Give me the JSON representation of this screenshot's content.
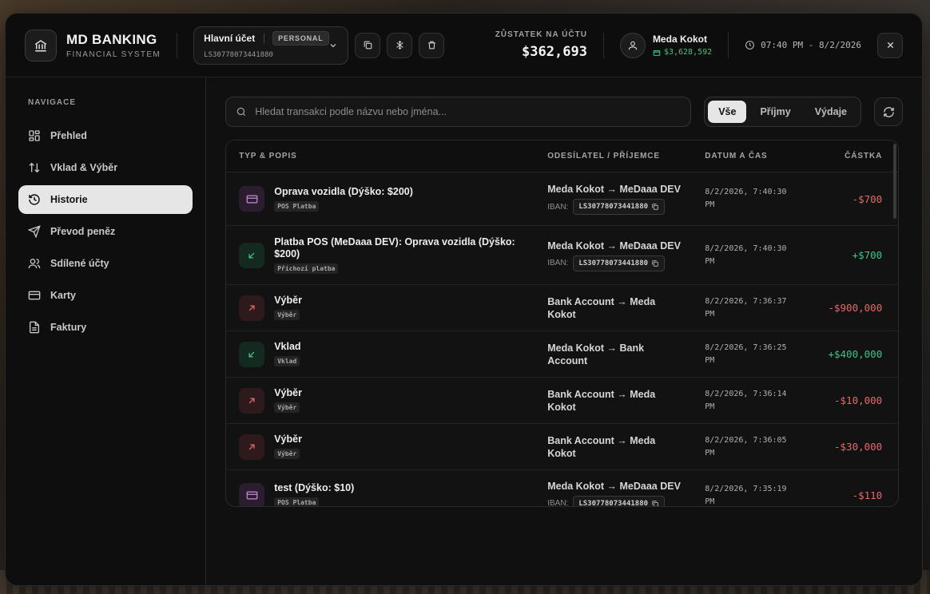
{
  "brand": {
    "title": "MD BANKING",
    "subtitle": "FINANCIAL SYSTEM"
  },
  "account": {
    "name": "Hlavní účet",
    "type_badge": "PERSONAL",
    "iban": "LS30778073441880"
  },
  "balance": {
    "label": "ZŮSTATEK NA ÚČTU",
    "value": "$362,693"
  },
  "user": {
    "name": "Meda Kokot",
    "cash": "$3,628,592"
  },
  "clock": {
    "text": "07:40 PM - 8/2/2026"
  },
  "nav": {
    "title": "NAVIGACE",
    "items": [
      {
        "label": "Přehled",
        "icon": "grid-icon"
      },
      {
        "label": "Vklad & Výběr",
        "icon": "arrows-up-down-icon"
      },
      {
        "label": "Historie",
        "icon": "history-icon",
        "active": true
      },
      {
        "label": "Převod peněz",
        "icon": "send-icon"
      },
      {
        "label": "Sdílené účty",
        "icon": "users-icon"
      },
      {
        "label": "Karty",
        "icon": "card-icon"
      },
      {
        "label": "Faktury",
        "icon": "invoice-icon"
      }
    ]
  },
  "search": {
    "placeholder": "Hledat transakci podle názvu nebo jména..."
  },
  "filters": [
    "Vše",
    "Příjmy",
    "Výdaje"
  ],
  "table": {
    "headers": [
      "TYP & POPIS",
      "ODESÍLATEL / PŘÍJEMCE",
      "DATUM A ČAS",
      "ČÁSTKA"
    ],
    "iban_label": "IBAN:",
    "rows": [
      {
        "kind": "pos",
        "title": "Oprava vozidla (Dýško: $200)",
        "tag": "POS Platba",
        "party": "Meda Kokot → MeDaaa DEV",
        "iban": "LS30778073441880",
        "date": "8/2/2026, 7:40:30",
        "ampm": "PM",
        "amount": "-$700",
        "sign": "neg"
      },
      {
        "kind": "in",
        "title": "Platba POS (MeDaaa DEV): Oprava vozidla (Dýško: $200)",
        "tag": "Příchozí platba",
        "party": "Meda Kokot → MeDaaa DEV",
        "iban": "LS30778073441880",
        "date": "8/2/2026, 7:40:30",
        "ampm": "PM",
        "amount": "+$700",
        "sign": "pos"
      },
      {
        "kind": "out",
        "title": "Výběr",
        "tag": "Výběr",
        "party": "Bank Account → Meda Kokot",
        "iban": "",
        "date": "8/2/2026, 7:36:37",
        "ampm": "PM",
        "amount": "-$900,000",
        "sign": "neg"
      },
      {
        "kind": "in",
        "title": "Vklad",
        "tag": "Vklad",
        "party": "Meda Kokot → Bank Account",
        "iban": "",
        "date": "8/2/2026, 7:36:25",
        "ampm": "PM",
        "amount": "+$400,000",
        "sign": "pos"
      },
      {
        "kind": "out",
        "title": "Výběr",
        "tag": "Výběr",
        "party": "Bank Account → Meda Kokot",
        "iban": "",
        "date": "8/2/2026, 7:36:14",
        "ampm": "PM",
        "amount": "-$10,000",
        "sign": "neg"
      },
      {
        "kind": "out",
        "title": "Výběr",
        "tag": "Výběr",
        "party": "Bank Account → Meda Kokot",
        "iban": "",
        "date": "8/2/2026, 7:36:05",
        "ampm": "PM",
        "amount": "-$30,000",
        "sign": "neg"
      },
      {
        "kind": "pos",
        "title": "test (Dýško: $10)",
        "tag": "POS Platba",
        "party": "Meda Kokot → MeDaaa DEV",
        "iban": "LS30778073441880",
        "date": "8/2/2026, 7:35:19",
        "ampm": "PM",
        "amount": "-$110",
        "sign": "neg"
      }
    ]
  },
  "colors": {
    "positive": "#3ec486",
    "negative": "#e36a6a",
    "active_bg": "#e6e6e6"
  }
}
